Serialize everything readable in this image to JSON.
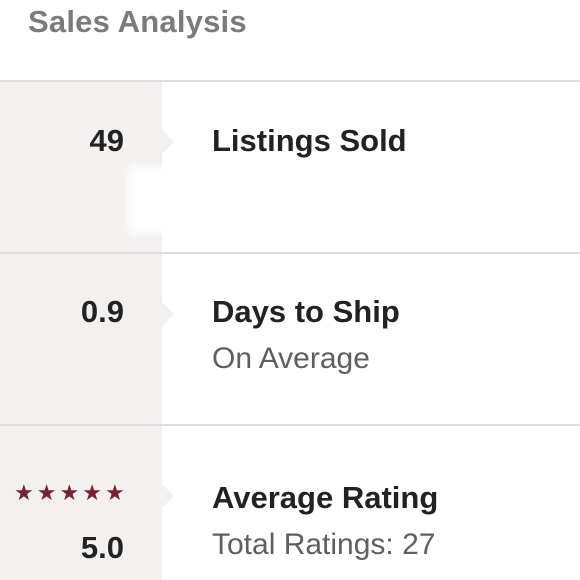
{
  "header": {
    "title": "Sales Analysis"
  },
  "stats": [
    {
      "value": "49",
      "title": "Listings Sold",
      "subtitle": ""
    },
    {
      "value": "0.9",
      "title": "Days to Ship",
      "subtitle": "On Average"
    },
    {
      "value": "5.0",
      "title": "Average Rating",
      "subtitle": "Total Ratings: 27",
      "stars": 5
    }
  ],
  "colors": {
    "header_text": "#7b7b7b",
    "primary_text": "#222222",
    "secondary_text": "#5f5f5f",
    "left_panel": "#f2f1ef",
    "star": "#7b1f33"
  },
  "icons": {
    "star": "star-icon"
  }
}
